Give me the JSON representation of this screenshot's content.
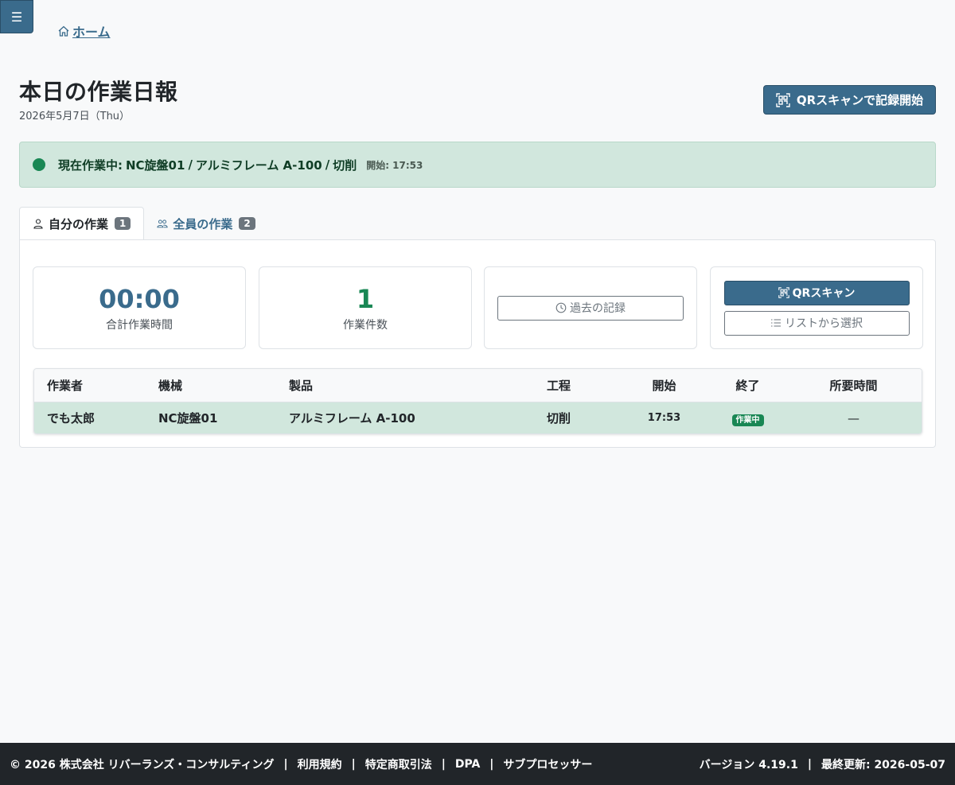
{
  "menu": {
    "icon": "☰"
  },
  "breadcrumb": {
    "home_label": "ホーム"
  },
  "header": {
    "title": "本日の作業日報",
    "date": "2026年5月7日（Thu）",
    "qr_start_label": "QRスキャンで記録開始"
  },
  "current": {
    "prefix": "現在作業中:",
    "machine": "NC旋盤01",
    "product": "アルミフレーム A-100",
    "process": "切削",
    "sep": "/",
    "start": "開始: 17:53"
  },
  "tabs": [
    {
      "label": "自分の作業",
      "count": "1"
    },
    {
      "label": "全員の作業",
      "count": "2"
    }
  ],
  "stats": {
    "total_time": "00:00",
    "total_time_label": "合計作業時間",
    "count": "1",
    "count_label": "作業件数"
  },
  "actions": {
    "history_label": "過去の記録",
    "qr_scan_label": "QRスキャン",
    "list_select_label": "リストから選択"
  },
  "table": {
    "headers": [
      "作業者",
      "機械",
      "製品",
      "工程",
      "開始",
      "終了",
      "所要時間"
    ],
    "rows": [
      {
        "worker": "でも太郎",
        "machine": "NC旋盤01",
        "product": "アルミフレーム A-100",
        "process": "切削",
        "start": "17:53",
        "end_status": "作業中",
        "duration": "—"
      }
    ]
  },
  "footer": {
    "copyright": "© 2026 株式会社 リバーランズ・コンサルティング",
    "links": [
      "利用規約",
      "特定商取引法",
      "DPA",
      "サブプロセッサー"
    ],
    "sep": "|",
    "version": "バージョン 4.19.1",
    "updated": "最終更新: 2026-05-07"
  },
  "colors": {
    "primary": "#3a6b8c",
    "success": "#198754",
    "banner_bg": "#d1e7dd",
    "footer_bg": "#212529"
  }
}
